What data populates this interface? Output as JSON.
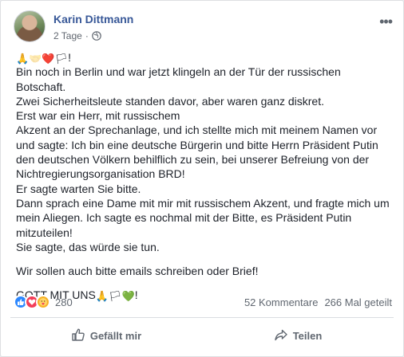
{
  "post": {
    "author": "Karin Dittmann",
    "time": "2 Tage",
    "separator": "·",
    "icons": {
      "privacy": "globe-icon",
      "menu": "more-options-icon"
    },
    "emojis": {
      "pray": "🙏",
      "handshake": "🤝",
      "heart": "❤️",
      "flag": "🏳",
      "green_heart": "💚"
    },
    "lines": [
      "Bin noch in Berlin und war jetzt klingeln an der Tür der russischen Botschaft.",
      "Zwei Sicherheitsleute standen davor, aber waren ganz diskret.",
      "Erst war ein Herr, mit russischem",
      "Akzent an der Sprechanlage, und ich stellte mich mit meinem Namen vor und sagte: Ich bin eine deutsche Bürgerin und bitte Herrn Präsident Putin den deutschen Völkern behilflich zu sein, bei unserer Befreiung von der Nichtregierungsorganisation BRD!",
      "Er sagte warten Sie bitte.",
      "Dann sprach eine Dame mit mir mit russischem Akzent, und fragte mich um mein Aliegen. Ich sagte es nochmal mit der Bitte, es Präsident Putin mitzuteilen!",
      "Sie sagte, das würde sie tun."
    ],
    "para2": "Wir sollen auch bitte emails schreiben oder Brief!",
    "closing": "GOTT MIT UNS",
    "exclaim": "!"
  },
  "stats": {
    "reaction_count": "280",
    "comments": "52 Kommentare",
    "shares": "266 Mal geteilt"
  },
  "actions": {
    "like": "Gefällt mir",
    "share": "Teilen"
  }
}
